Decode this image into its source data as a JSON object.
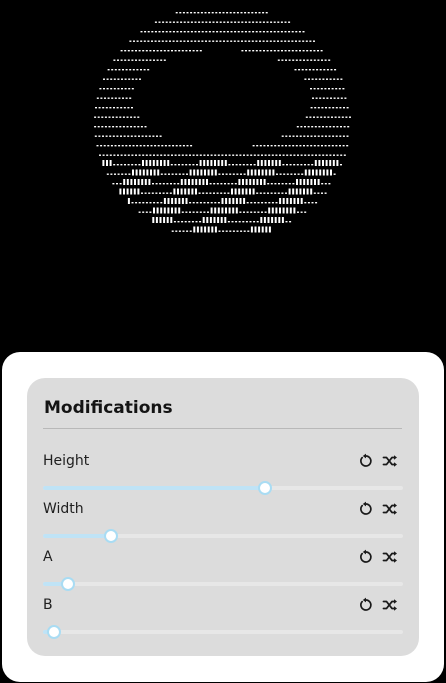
{
  "panel": {
    "title": "Modifications"
  },
  "controls": [
    {
      "label": "Height",
      "value_fraction": 0.617
    },
    {
      "label": "Width",
      "value_fraction": 0.19
    },
    {
      "label": "A",
      "value_fraction": 0.07
    },
    {
      "label": "B",
      "value_fraction": 0.03
    }
  ],
  "icons": {
    "reset": "reset-icon",
    "shuffle": "shuffle-icon"
  },
  "colors": {
    "background": "#000000",
    "ascii_art": "#ffffff",
    "card": "#dcdcdc",
    "slider_fill": "#bfe3f6",
    "slider_thumb_border": "#a9dcf3"
  }
}
